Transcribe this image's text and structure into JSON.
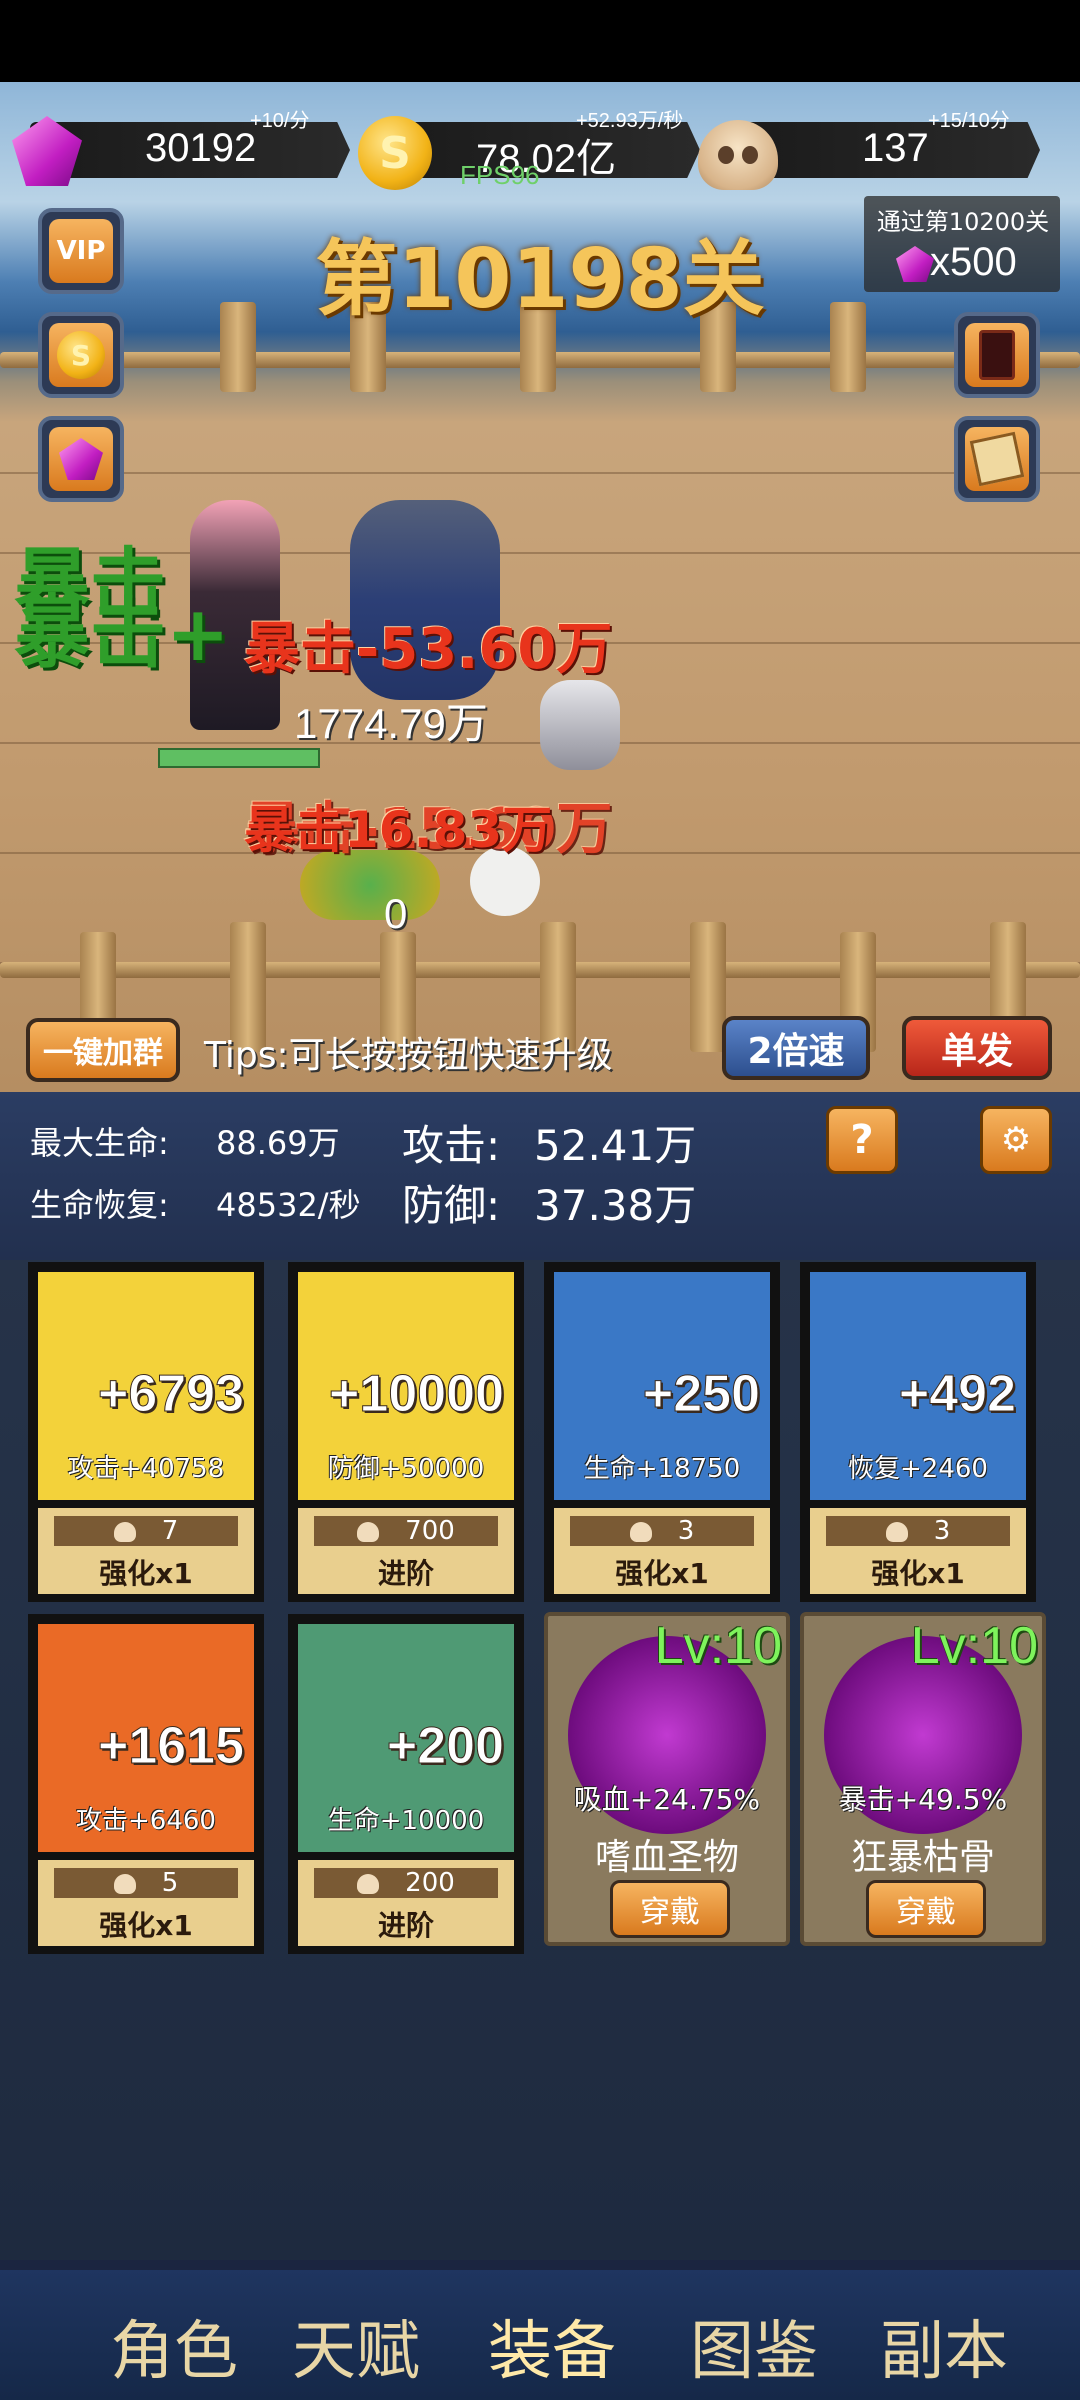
{
  "currencies": {
    "gems": {
      "value": "30192",
      "rate": "+10/分",
      "icon": "gem-icon"
    },
    "gold": {
      "value": "78.02亿",
      "rate": "+52.93万/秒",
      "icon": "coin-icon"
    },
    "skulls": {
      "value": "137",
      "rate": "+15/10分",
      "icon": "skull-icon"
    }
  },
  "fps": "FPS96",
  "level_title": "第10198关",
  "pass_reward": {
    "label": "通过第10200关",
    "amount": "x500"
  },
  "side_buttons": {
    "vip": "VIP"
  },
  "battle": {
    "crit_text_1": "暴击",
    "crit_text_2": "暴击+",
    "dmg_1": "暴击-53.60万",
    "dmg_2": "暴击16.83万",
    "dmg_3": "暴击-15.60万",
    "num_1": "1774.79万",
    "num_2": "0"
  },
  "controls": {
    "join_group": "一键加群",
    "tips": "Tips:可长按按钮快速升级",
    "speed": "2倍速",
    "fire_mode": "单发"
  },
  "stats": {
    "max_hp_label": "最大生命:",
    "max_hp": "88.69万",
    "regen_label": "生命恢复:",
    "regen": "48532/秒",
    "attack_label": "攻击:",
    "attack": "52.41万",
    "defense_label": "防御:",
    "defense": "37.38万",
    "help": "?"
  },
  "equipment": [
    {
      "plus": "+6793",
      "sub": "攻击+40758",
      "cost": "7",
      "action": "强化x1",
      "color": "#f3d23a"
    },
    {
      "plus": "+10000",
      "sub": "防御+50000",
      "cost": "700",
      "action": "进阶",
      "color": "#f3d23a"
    },
    {
      "plus": "+250",
      "sub": "生命+18750",
      "cost": "3",
      "action": "强化x1",
      "color": "#3a78c6"
    },
    {
      "plus": "+492",
      "sub": "恢复+2460",
      "cost": "3",
      "action": "强化x1",
      "color": "#3a78c6"
    },
    {
      "plus": "+1615",
      "sub": "攻击+6460",
      "cost": "5",
      "action": "强化x1",
      "color": "#ea6a26"
    },
    {
      "plus": "+200",
      "sub": "生命+10000",
      "cost": "200",
      "action": "进阶",
      "color": "#4f9a74"
    }
  ],
  "relics": [
    {
      "level": "Lv:10",
      "effect": "吸血+24.75%",
      "name": "嗜血圣物",
      "button": "穿戴"
    },
    {
      "level": "Lv:10",
      "effect": "暴击+49.5%",
      "name": "狂暴枯骨",
      "button": "穿戴"
    }
  ],
  "nav": [
    "角色",
    "天赋",
    "装备",
    "图鉴",
    "副本"
  ]
}
